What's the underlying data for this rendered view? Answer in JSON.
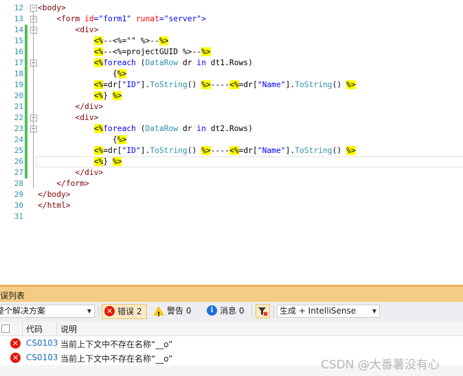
{
  "editor": {
    "lines": [
      {
        "n": "12",
        "segs": [
          [
            "tag",
            "<body>"
          ]
        ]
      },
      {
        "n": "13",
        "segs": [
          [
            "txt",
            "    "
          ],
          [
            "tag",
            "<form "
          ],
          [
            "attr",
            "id"
          ],
          [
            "blue",
            "="
          ],
          [
            "str",
            "\"form1\" "
          ],
          [
            "attr",
            "runat"
          ],
          [
            "blue",
            "="
          ],
          [
            "str",
            "\"server\""
          ],
          [
            "blue",
            ">"
          ]
        ]
      },
      {
        "n": "14",
        "segs": [
          [
            "txt",
            "        "
          ],
          [
            "tag",
            "<div>"
          ]
        ]
      },
      {
        "n": "15",
        "segs": [
          [
            "txt",
            "            "
          ],
          [
            "hl",
            "<%"
          ],
          [
            "txt",
            "--<%=\"\" %>--"
          ],
          [
            "hl",
            "%>"
          ]
        ]
      },
      {
        "n": "16",
        "segs": [
          [
            "txt",
            "            "
          ],
          [
            "hl",
            "<%"
          ],
          [
            "txt",
            "--<%=projectGUID %>--"
          ],
          [
            "hl",
            "%>"
          ]
        ]
      },
      {
        "n": "17",
        "segs": [
          [
            "txt",
            "            "
          ],
          [
            "hl",
            "<%"
          ],
          [
            "blue",
            "foreach"
          ],
          [
            "txt",
            " ("
          ],
          [
            "type",
            "DataRow"
          ],
          [
            "txt",
            " dr "
          ],
          [
            "blue",
            "in"
          ],
          [
            "txt",
            " dt1.Rows)"
          ]
        ]
      },
      {
        "n": "18",
        "segs": [
          [
            "txt",
            "                "
          ],
          [
            "txt",
            "{"
          ],
          [
            "hl",
            "%>"
          ]
        ]
      },
      {
        "n": "19",
        "segs": [
          [
            "txt",
            "            "
          ],
          [
            "hl",
            "<%"
          ],
          [
            "txt",
            "=dr["
          ],
          [
            "str",
            "\"ID\""
          ],
          [
            "txt",
            "]."
          ],
          [
            "type",
            "ToString"
          ],
          [
            "txt",
            "() "
          ],
          [
            "hl",
            "%>"
          ],
          [
            "txt",
            "----"
          ],
          [
            "hl",
            "<%"
          ],
          [
            "txt",
            "=dr["
          ],
          [
            "str",
            "\"Name\""
          ],
          [
            "txt",
            "]."
          ],
          [
            "type",
            "ToString"
          ],
          [
            "txt",
            "() "
          ],
          [
            "hl",
            "%>"
          ]
        ]
      },
      {
        "n": "20",
        "segs": [
          [
            "txt",
            "            "
          ],
          [
            "hl",
            "<%"
          ],
          [
            "txt",
            "} "
          ],
          [
            "hl",
            "%>"
          ]
        ]
      },
      {
        "n": "21",
        "segs": [
          [
            "txt",
            "        "
          ],
          [
            "tag",
            "</div>"
          ]
        ]
      },
      {
        "n": "22",
        "segs": [
          [
            "txt",
            "        "
          ],
          [
            "tag",
            "<div>"
          ]
        ]
      },
      {
        "n": "23",
        "segs": [
          [
            "txt",
            "            "
          ],
          [
            "hl",
            "<%"
          ],
          [
            "blue",
            "foreach"
          ],
          [
            "txt",
            " ("
          ],
          [
            "type",
            "DataRow"
          ],
          [
            "txt",
            " dr "
          ],
          [
            "blue",
            "in"
          ],
          [
            "txt",
            " dt2.Rows)"
          ]
        ]
      },
      {
        "n": "24",
        "segs": [
          [
            "txt",
            "                "
          ],
          [
            "txt",
            "{"
          ],
          [
            "hl",
            "%>"
          ]
        ]
      },
      {
        "n": "25",
        "segs": [
          [
            "txt",
            "            "
          ],
          [
            "hl",
            "<%"
          ],
          [
            "txt",
            "=dr["
          ],
          [
            "str",
            "\"ID\""
          ],
          [
            "txt",
            "]."
          ],
          [
            "type",
            "ToString"
          ],
          [
            "txt",
            "() "
          ],
          [
            "hl",
            "%>"
          ],
          [
            "txt",
            "----"
          ],
          [
            "hl",
            "<%"
          ],
          [
            "txt",
            "=dr["
          ],
          [
            "str",
            "\"Name\""
          ],
          [
            "txt",
            "]."
          ],
          [
            "type",
            "ToString"
          ],
          [
            "txt",
            "() "
          ],
          [
            "hl",
            "%>"
          ]
        ]
      },
      {
        "n": "26",
        "segs": [
          [
            "txt",
            "            "
          ],
          [
            "hl",
            "<%"
          ],
          [
            "txt",
            "} "
          ],
          [
            "hl",
            "%>"
          ]
        ]
      },
      {
        "n": "27",
        "segs": [
          [
            "txt",
            "        "
          ],
          [
            "tag",
            "</div>"
          ]
        ]
      },
      {
        "n": "28",
        "segs": [
          [
            "txt",
            "    "
          ],
          [
            "tag",
            "</form>"
          ]
        ]
      },
      {
        "n": "29",
        "segs": [
          [
            "tag",
            "</body>"
          ]
        ]
      },
      {
        "n": "30",
        "segs": [
          [
            "tag",
            "</html>"
          ]
        ]
      },
      {
        "n": "31",
        "segs": []
      }
    ]
  },
  "error_list": {
    "title": "误列表",
    "scope": "整个解决方案",
    "errors_label": "错误 2",
    "warnings_label": "警告 0",
    "messages_label": "消息 0",
    "build_filter": "生成 + IntelliSense",
    "col_code": "代码",
    "col_desc": "说明",
    "rows": [
      {
        "code": "CS0103",
        "desc": "当前上下文中不存在名称“__o”"
      },
      {
        "code": "CS0103",
        "desc": "当前上下文中不存在名称“__o”"
      }
    ]
  },
  "watermark": "CSDN @大番薯没有心",
  "colors": {
    "tag": "#800000",
    "attr": "#ff0000",
    "string": "#0000ff",
    "keyword": "#0000ff",
    "type": "#2b91af",
    "highlight": "#ffff00",
    "error": "#e51400",
    "panel_title": "#f5cc84"
  }
}
